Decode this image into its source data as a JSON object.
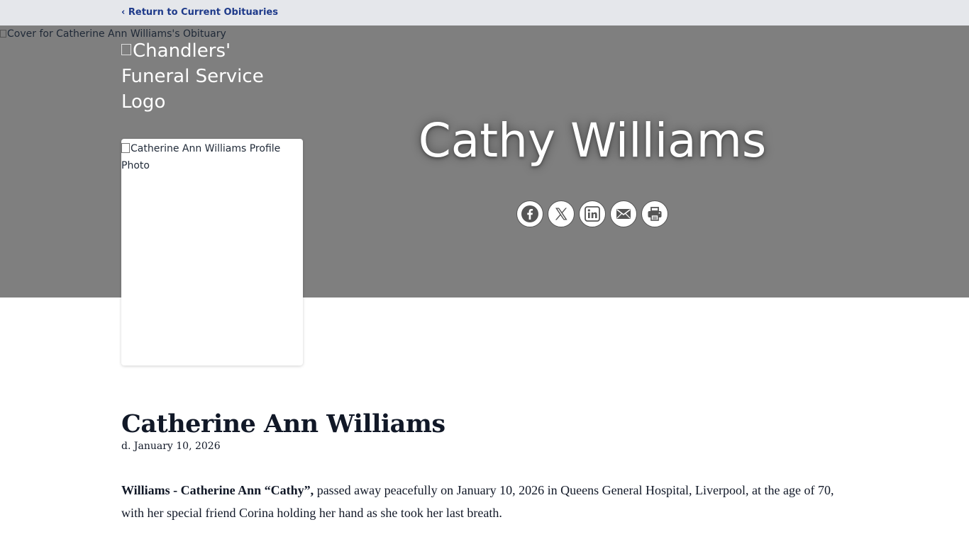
{
  "nav": {
    "back_label": "‹ Return to Current Obituaries"
  },
  "hero": {
    "cover_alt": "Cover for Catherine Ann Williams's Obituary",
    "logo_alt": "Chandlers' Funeral Service Logo",
    "display_name": "Cathy Williams",
    "profile_alt": "Catherine Ann Williams Profile Photo",
    "share_buttons": [
      {
        "name": "facebook-icon"
      },
      {
        "name": "x-icon"
      },
      {
        "name": "linkedin-icon"
      },
      {
        "name": "email-icon"
      },
      {
        "name": "print-icon"
      }
    ]
  },
  "obituary": {
    "full_name": "Catherine Ann Williams",
    "death_date": "d. January 10, 2026",
    "lead_bold": "Williams - Catherine Ann “Cathy”,",
    "lead_text": " passed away peacefully on January 10, 2026 in Queens General Hospital, Liverpool, at the age of 70, with her special friend Corina holding her hand as she took her last breath."
  },
  "colors": {
    "topbar": "#e5e7eb",
    "link": "#1e3a8a",
    "hero": "#7f7f7f",
    "text": "#111827"
  }
}
